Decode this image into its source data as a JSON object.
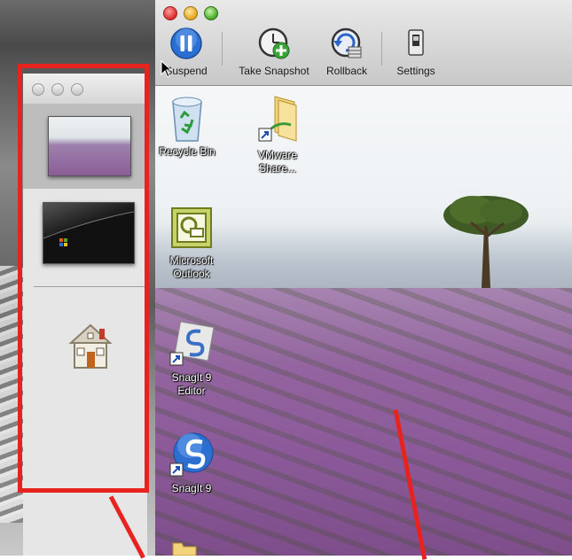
{
  "toolbar": {
    "suspend_label": "Suspend",
    "snapshot_label": "Take Snapshot",
    "rollback_label": "Rollback",
    "settings_label": "Settings"
  },
  "desktop_icons": [
    {
      "label": "Recycle Bin"
    },
    {
      "label": "VMware\nShare..."
    },
    {
      "label": "Microsoft\nOutlook"
    },
    {
      "label": "SnagIt 9\nEditor"
    },
    {
      "label": "SnagIt 9"
    }
  ],
  "colors": {
    "annotation": "#e8221f",
    "lavender": "#8c5a9a"
  }
}
